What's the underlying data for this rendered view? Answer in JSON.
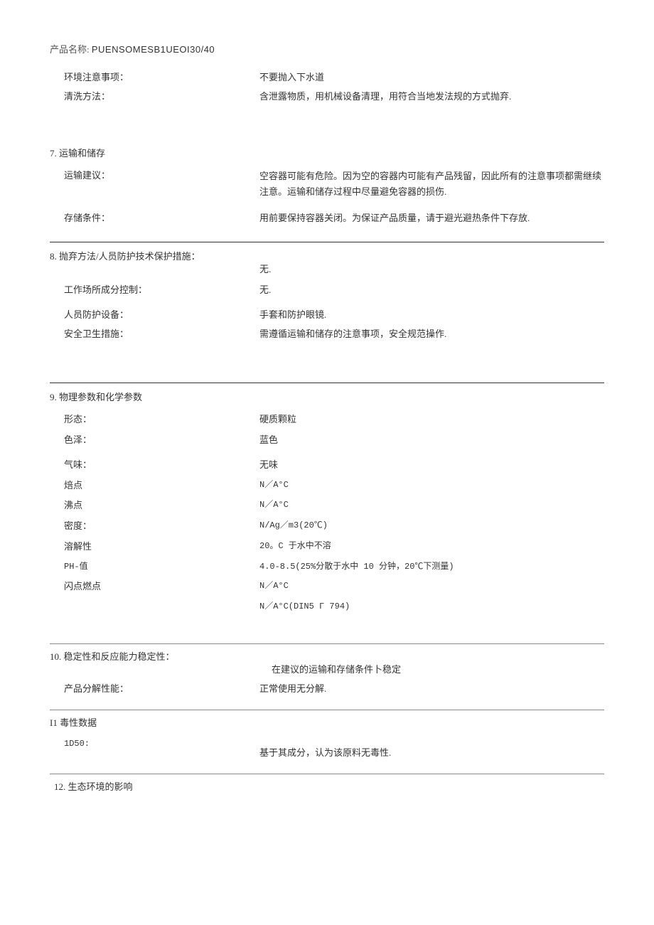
{
  "header": {
    "label": "产品名称: ",
    "product": "PUENSOMESB1UEOI30/40"
  },
  "s6": {
    "rows": [
      {
        "label": "环境注意事项：",
        "value": "不要抛入下水道"
      },
      {
        "label": "清洗方法：",
        "value": "含泄露物质，用机械设备清理，用符合当地发法规的方式抛弃."
      }
    ]
  },
  "s7": {
    "title": "7. 运输和储存",
    "rows": [
      {
        "label": "运输建议：",
        "value": "空容器可能有危险。因为空的容器内可能有产品残留，因此所有的注意事项都需继续注意。运输和储存过程中尽量避免容器的损伤."
      },
      {
        "label": "存储条件：",
        "value": "用前要保持容器关闭。为保证产品质量，请于避光避热条件下存放."
      }
    ]
  },
  "s8": {
    "title": "8. 抛弃方法/人员防护技术保护措施：",
    "title_value": "无.",
    "rows": [
      {
        "label": "工作场所成分控制：",
        "value": "无."
      },
      {
        "label": "人员防护设备：",
        "value": "手套和防护眼镜."
      },
      {
        "label": "安全卫生措施：",
        "value": "需遵循运输和储存的注意事项，安全规范操作."
      }
    ]
  },
  "s9": {
    "title": "9. 物理参数和化学参数",
    "rows": [
      {
        "label": "形态：",
        "value": "硬质颗粒"
      },
      {
        "label": "色泽：",
        "value": "蓝色"
      },
      {
        "label": "气味：",
        "value": "无味"
      },
      {
        "label": "焙点",
        "value": "N／A°C"
      },
      {
        "label": "沸点",
        "value": "N／A°C"
      },
      {
        "label": "密度：",
        "value": "N/Ag／m3(20℃)"
      },
      {
        "label": "溶解性",
        "value": "20。C 于水中不溶"
      },
      {
        "label": "PH-值",
        "value": "4.0-8.5(25%分散于水中 10 分钟，20℃下测量)"
      },
      {
        "label": "闪点燃点",
        "value": "N／A°C"
      },
      {
        "label": "",
        "value": "N／A°C(DIN5 Γ 794)"
      }
    ]
  },
  "s10": {
    "title": "10. 稳定性和反应能力稳定性：",
    "title_value": "在建议的运输和存储条件卜稳定",
    "rows": [
      {
        "label": "产品分解性能：",
        "value": "正常使用无分解."
      }
    ]
  },
  "s11": {
    "title": "I1 毒性数据",
    "rows": [
      {
        "label": "1D50:",
        "value": "基于其成分，认为该原料无毒性."
      }
    ]
  },
  "s12": {
    "title": "12. 生态环境的影响"
  }
}
